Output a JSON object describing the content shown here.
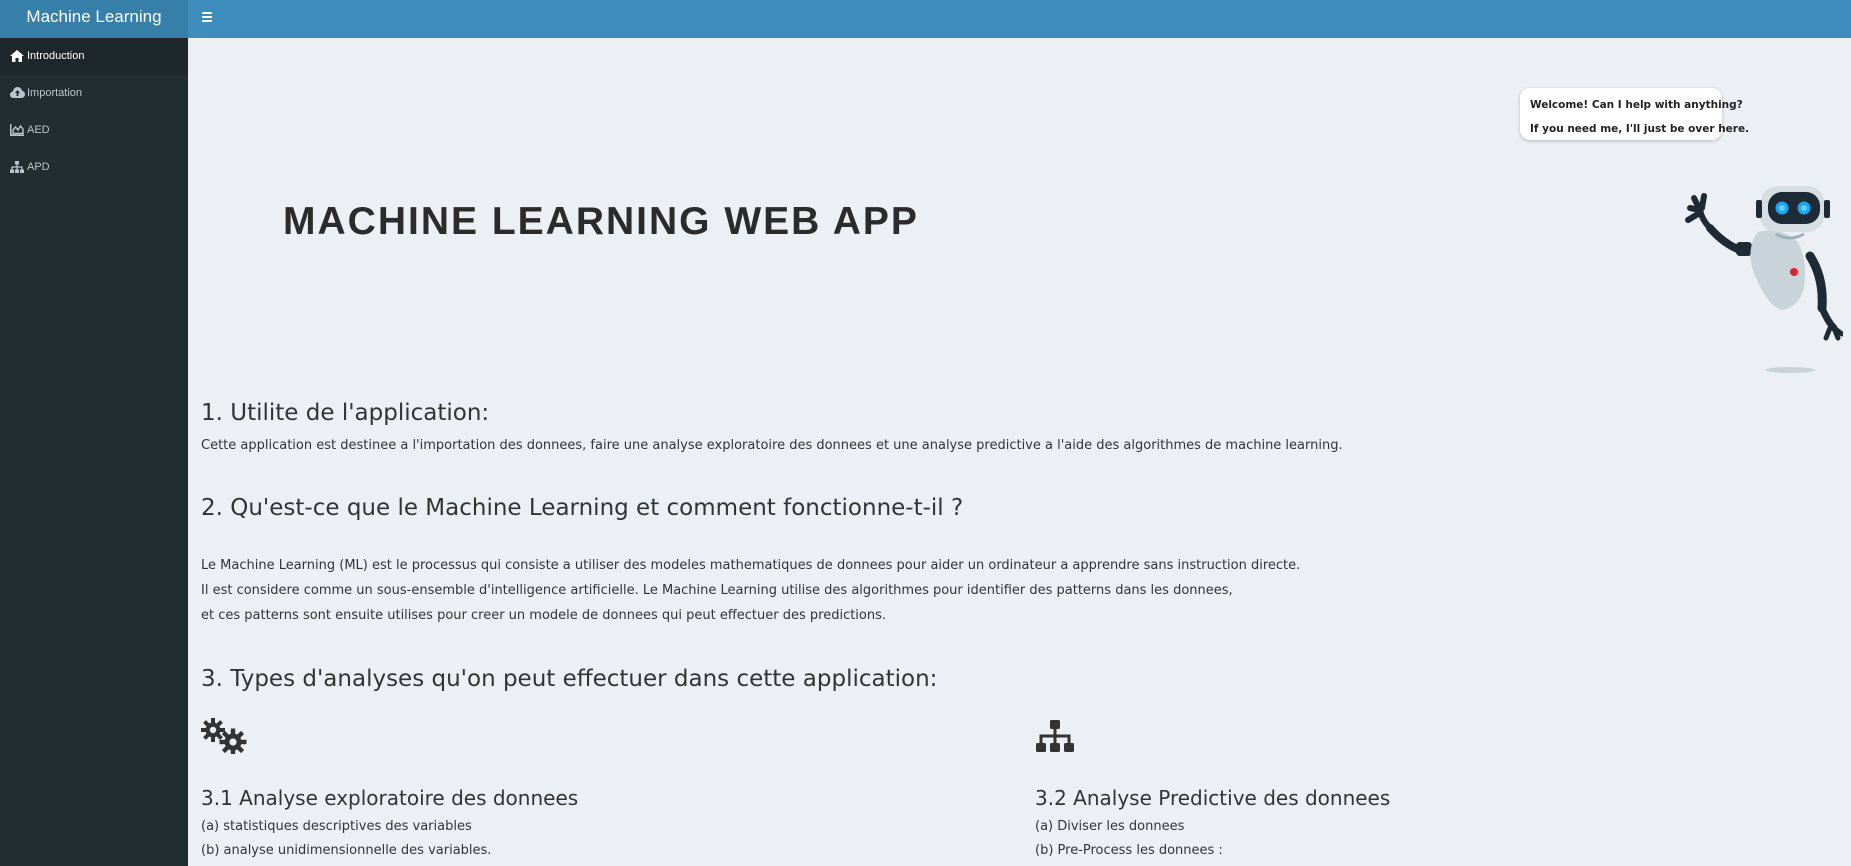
{
  "header": {
    "app_title": "Machine Learning"
  },
  "sidebar": {
    "items": [
      {
        "label": "Introduction",
        "icon": "home-icon",
        "active": true
      },
      {
        "label": "Importation",
        "icon": "cloud-upload-icon",
        "active": false
      },
      {
        "label": "AED",
        "icon": "area-chart-icon",
        "active": false
      },
      {
        "label": "APD",
        "icon": "sitemap-icon",
        "active": false
      }
    ]
  },
  "hero": {
    "title": "MACHINE LEARNING WEB APP",
    "bubble_line1": "Welcome! Can I help with anything?",
    "bubble_line2": "If you need me, I'll just be over here."
  },
  "sections": {
    "s1": {
      "title": "1. Utilite de l'application:",
      "text": "Cette application est destinee a l'importation des donnees, faire une analyse exploratoire des donnees et une analyse predictive a l'aide des algorithmes de machine learning."
    },
    "s2": {
      "title": "2. Qu'est-ce que le Machine Learning et comment fonctionne-t-il ?",
      "line1": "Le Machine Learning (ML) est le processus qui consiste a utiliser des modeles mathematiques de donnees pour aider un ordinateur a apprendre sans instruction directe.",
      "line2": "Il est considere comme un sous-ensemble d'intelligence artificielle. Le Machine Learning utilise des algorithmes pour identifier des patterns dans les donnees,",
      "line3": "et ces patterns sont ensuite utilises pour creer un modele de donnees qui peut effectuer des predictions."
    },
    "s3": {
      "title": "3. Types d'analyses qu'on peut effectuer dans cette application:",
      "left": {
        "icon": "cogs-icon",
        "title": "3.1 Analyse exploratoire des donnees",
        "items": [
          "(a) statistiques descriptives des variables",
          "(b) analyse unidimensionnelle des variables."
        ]
      },
      "right": {
        "icon": "sitemap-icon",
        "title": "3.2 Analyse Predictive des donnees",
        "items": [
          "(a) Diviser les donnees",
          "(b) Pre-Process les donnees :"
        ]
      }
    }
  },
  "colors": {
    "header": "#3c8dbc",
    "logo_bg": "#367fa9",
    "sidebar": "#222d32",
    "sidebar_active": "#1e282c",
    "content_bg": "#ecf0f5"
  }
}
